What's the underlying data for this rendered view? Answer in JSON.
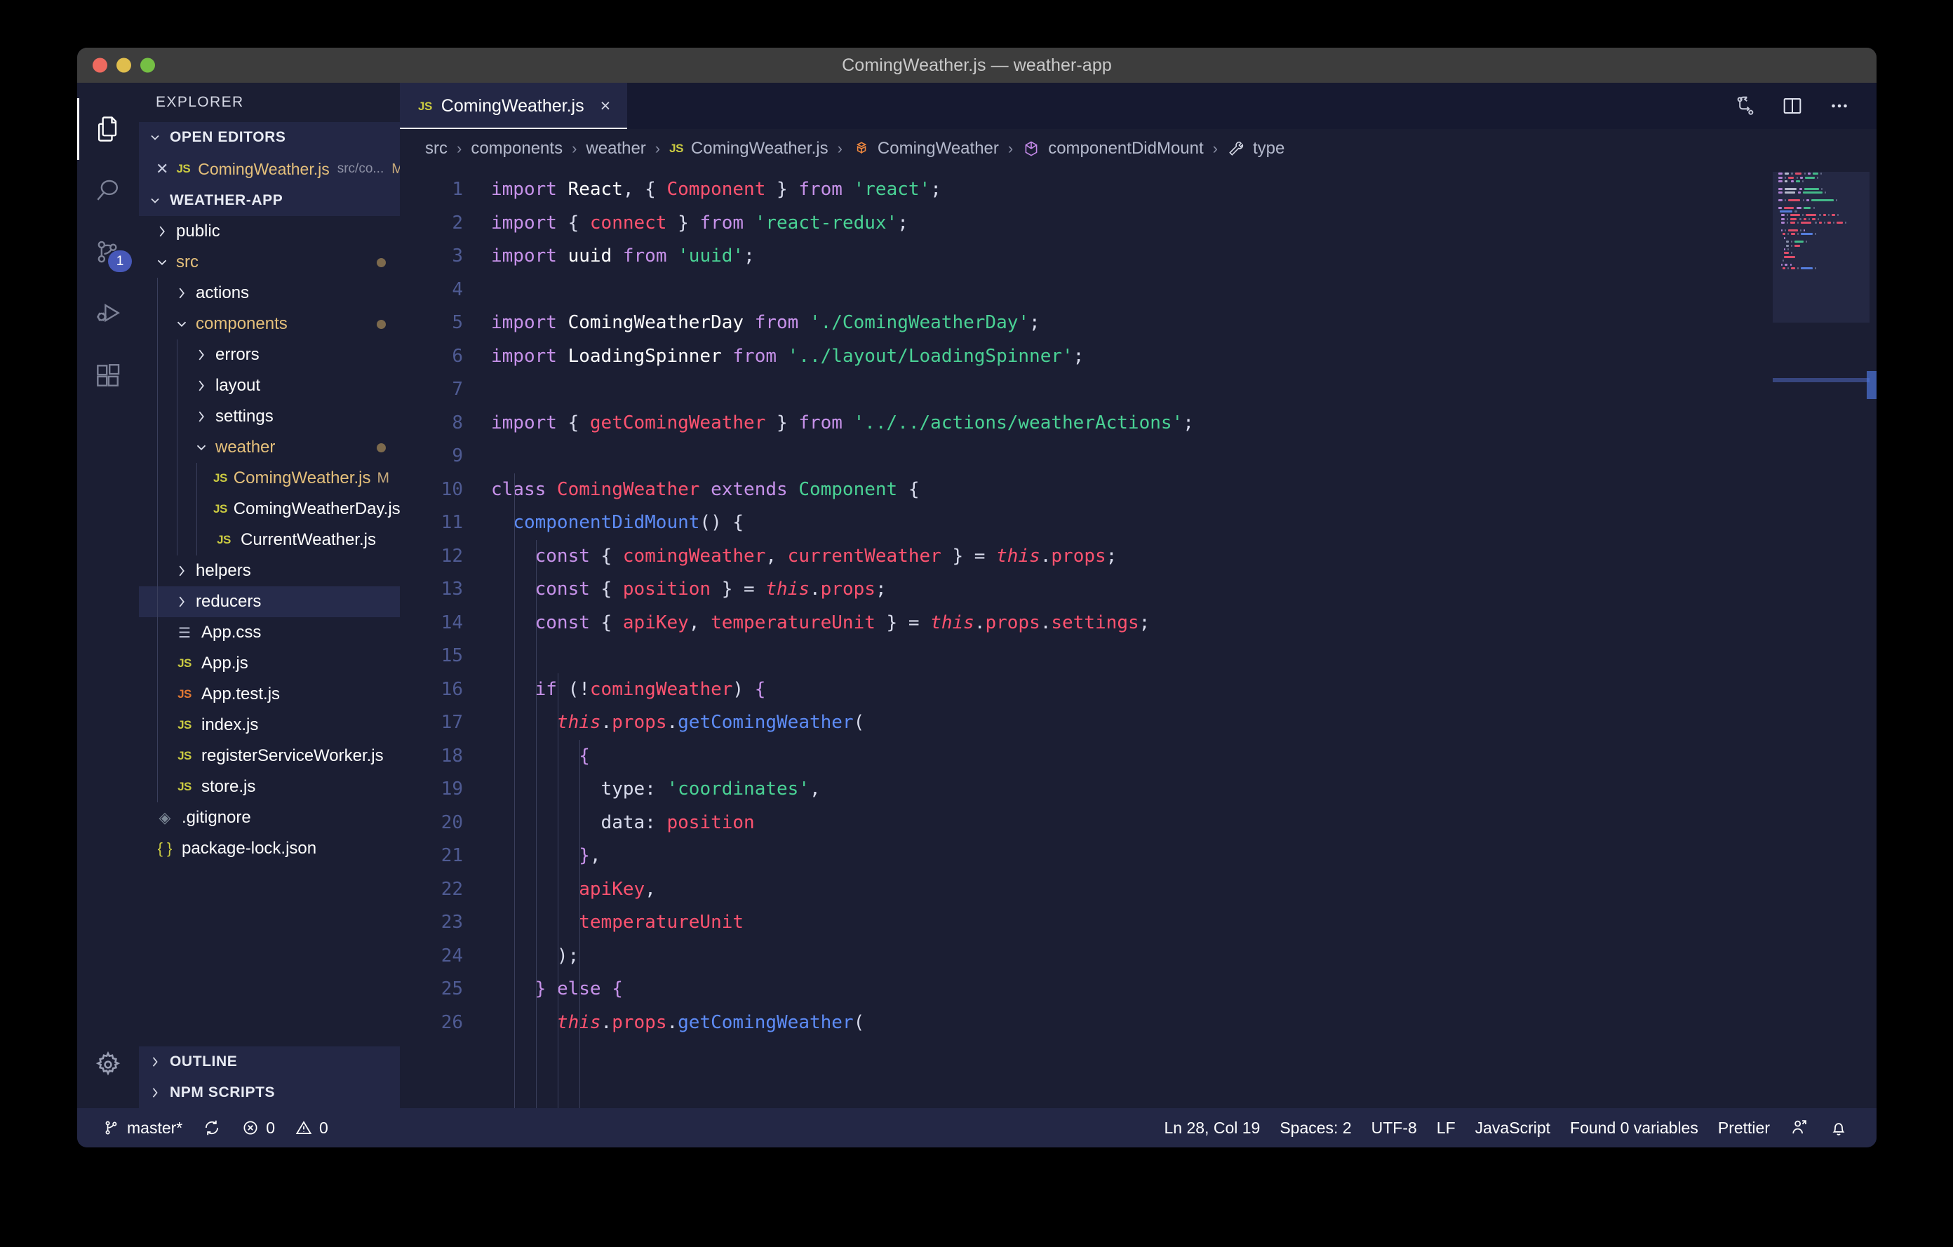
{
  "titlebar": {
    "title": "ComingWeather.js — weather-app"
  },
  "activitybar": {
    "items": [
      {
        "icon": "explorer-files-icon",
        "active": true
      },
      {
        "icon": "search-icon",
        "active": false
      },
      {
        "icon": "source-control-icon",
        "active": false,
        "badge": "1"
      },
      {
        "icon": "run-and-debug-icon",
        "active": false
      },
      {
        "icon": "extensions-icon",
        "active": false
      }
    ],
    "bottom": {
      "icon": "settings-gear-icon"
    }
  },
  "sidebar": {
    "title": "EXPLORER",
    "open_editors": {
      "header": "OPEN EDITORS",
      "items": [
        {
          "name": "ComingWeather.js",
          "path": "src/co...",
          "status": "M",
          "icon": "js-icon"
        }
      ]
    },
    "workspace": {
      "header": "WEATHER-APP",
      "tree": [
        {
          "label": "public",
          "type": "folder",
          "depth": 1,
          "expanded": false
        },
        {
          "label": "src",
          "type": "folder",
          "depth": 1,
          "expanded": true,
          "modified": true
        },
        {
          "label": "actions",
          "type": "folder",
          "depth": 2,
          "expanded": false
        },
        {
          "label": "components",
          "type": "folder",
          "depth": 2,
          "expanded": true,
          "modified": true
        },
        {
          "label": "errors",
          "type": "folder",
          "depth": 3,
          "expanded": false
        },
        {
          "label": "layout",
          "type": "folder",
          "depth": 3,
          "expanded": false
        },
        {
          "label": "settings",
          "type": "folder",
          "depth": 3,
          "expanded": false
        },
        {
          "label": "weather",
          "type": "folder",
          "depth": 3,
          "expanded": true,
          "modified": true
        },
        {
          "label": "ComingWeather.js",
          "type": "file",
          "depth": 4,
          "icon": "js-icon",
          "status": "M",
          "modified": true
        },
        {
          "label": "ComingWeatherDay.js",
          "type": "file",
          "depth": 4,
          "icon": "js-icon"
        },
        {
          "label": "CurrentWeather.js",
          "type": "file",
          "depth": 4,
          "icon": "js-icon"
        },
        {
          "label": "helpers",
          "type": "folder",
          "depth": 2,
          "expanded": false
        },
        {
          "label": "reducers",
          "type": "folder",
          "depth": 2,
          "expanded": false,
          "selected": true
        },
        {
          "label": "App.css",
          "type": "file",
          "depth": 2,
          "icon": "css-icon"
        },
        {
          "label": "App.js",
          "type": "file",
          "depth": 2,
          "icon": "js-icon"
        },
        {
          "label": "App.test.js",
          "type": "file",
          "depth": 2,
          "icon": "js-test-icon"
        },
        {
          "label": "index.js",
          "type": "file",
          "depth": 2,
          "icon": "js-icon"
        },
        {
          "label": "registerServiceWorker.js",
          "type": "file",
          "depth": 2,
          "icon": "js-icon"
        },
        {
          "label": "store.js",
          "type": "file",
          "depth": 2,
          "icon": "js-icon"
        },
        {
          "label": ".gitignore",
          "type": "file",
          "depth": 1,
          "icon": "git-icon"
        },
        {
          "label": "package-lock.json",
          "type": "file",
          "depth": 1,
          "icon": "json-icon"
        }
      ]
    },
    "outline_header": "OUTLINE",
    "npm_scripts_header": "NPM SCRIPTS"
  },
  "editor": {
    "tabs": [
      {
        "label": "ComingWeather.js",
        "icon": "js-icon",
        "close": "×",
        "active": true
      }
    ],
    "actions": [
      {
        "icon": "split-changes-icon"
      },
      {
        "icon": "split-editor-icon"
      },
      {
        "icon": "more-actions-icon"
      }
    ],
    "breadcrumb": [
      {
        "label": "src",
        "icon": null
      },
      {
        "label": "components",
        "icon": null
      },
      {
        "label": "weather",
        "icon": null
      },
      {
        "label": "ComingWeather.js",
        "icon": "js-icon"
      },
      {
        "label": "ComingWeather",
        "icon": "class-symbol-icon"
      },
      {
        "label": "componentDidMount",
        "icon": "method-symbol-icon"
      },
      {
        "label": "type",
        "icon": "property-symbol-icon"
      }
    ],
    "first_line": 1,
    "line_count": 26,
    "language": "JavaScript",
    "code_lines": [
      {
        "n": 1,
        "tokens": [
          {
            "t": "import ",
            "c": "kw"
          },
          {
            "t": "React",
            "c": "id"
          },
          {
            "t": ", { ",
            "c": "pl"
          },
          {
            "t": "Component",
            "c": "var"
          },
          {
            "t": " } ",
            "c": "pl"
          },
          {
            "t": "from ",
            "c": "kw"
          },
          {
            "t": "'react'",
            "c": "str"
          },
          {
            "t": ";",
            "c": "pl"
          }
        ]
      },
      {
        "n": 2,
        "tokens": [
          {
            "t": "import ",
            "c": "kw"
          },
          {
            "t": "{ ",
            "c": "pl"
          },
          {
            "t": "connect",
            "c": "var"
          },
          {
            "t": " } ",
            "c": "pl"
          },
          {
            "t": "from ",
            "c": "kw"
          },
          {
            "t": "'react-redux'",
            "c": "str"
          },
          {
            "t": ";",
            "c": "pl"
          }
        ]
      },
      {
        "n": 3,
        "tokens": [
          {
            "t": "import ",
            "c": "kw"
          },
          {
            "t": "uuid",
            "c": "id"
          },
          {
            "t": " ",
            "c": "pl"
          },
          {
            "t": "from ",
            "c": "kw"
          },
          {
            "t": "'uuid'",
            "c": "str"
          },
          {
            "t": ";",
            "c": "pl"
          }
        ]
      },
      {
        "n": 4,
        "tokens": []
      },
      {
        "n": 5,
        "tokens": [
          {
            "t": "import ",
            "c": "kw"
          },
          {
            "t": "ComingWeatherDay",
            "c": "id"
          },
          {
            "t": " ",
            "c": "pl"
          },
          {
            "t": "from ",
            "c": "kw"
          },
          {
            "t": "'./ComingWeatherDay'",
            "c": "str"
          },
          {
            "t": ";",
            "c": "pl"
          }
        ]
      },
      {
        "n": 6,
        "tokens": [
          {
            "t": "import ",
            "c": "kw"
          },
          {
            "t": "LoadingSpinner",
            "c": "id"
          },
          {
            "t": " ",
            "c": "pl"
          },
          {
            "t": "from ",
            "c": "kw"
          },
          {
            "t": "'../layout/LoadingSpinner'",
            "c": "str"
          },
          {
            "t": ";",
            "c": "pl"
          }
        ]
      },
      {
        "n": 7,
        "tokens": []
      },
      {
        "n": 8,
        "tokens": [
          {
            "t": "import ",
            "c": "kw"
          },
          {
            "t": "{ ",
            "c": "pl"
          },
          {
            "t": "getComingWeather",
            "c": "var"
          },
          {
            "t": " } ",
            "c": "pl"
          },
          {
            "t": "from ",
            "c": "kw"
          },
          {
            "t": "'../../actions/weatherActions'",
            "c": "str"
          },
          {
            "t": ";",
            "c": "pl"
          }
        ]
      },
      {
        "n": 9,
        "tokens": []
      },
      {
        "n": 10,
        "tokens": [
          {
            "t": "class ",
            "c": "kw"
          },
          {
            "t": "ComingWeather",
            "c": "var"
          },
          {
            "t": " extends ",
            "c": "kw"
          },
          {
            "t": "Component",
            "c": "cls"
          },
          {
            "t": " {",
            "c": "pl"
          }
        ]
      },
      {
        "n": 11,
        "tokens": [
          {
            "t": "  ",
            "c": "pl"
          },
          {
            "t": "componentDidMount",
            "c": "fn"
          },
          {
            "t": "() {",
            "c": "pl"
          }
        ]
      },
      {
        "n": 12,
        "tokens": [
          {
            "t": "    ",
            "c": "pl"
          },
          {
            "t": "const ",
            "c": "kw"
          },
          {
            "t": "{ ",
            "c": "pl"
          },
          {
            "t": "comingWeather",
            "c": "var"
          },
          {
            "t": ", ",
            "c": "pl"
          },
          {
            "t": "currentWeather",
            "c": "var"
          },
          {
            "t": " } = ",
            "c": "pl"
          },
          {
            "t": "this",
            "c": "var it"
          },
          {
            "t": ".",
            "c": "pl"
          },
          {
            "t": "props",
            "c": "var"
          },
          {
            "t": ";",
            "c": "pl"
          }
        ]
      },
      {
        "n": 13,
        "tokens": [
          {
            "t": "    ",
            "c": "pl"
          },
          {
            "t": "const ",
            "c": "kw"
          },
          {
            "t": "{ ",
            "c": "pl"
          },
          {
            "t": "position",
            "c": "var"
          },
          {
            "t": " } = ",
            "c": "pl"
          },
          {
            "t": "this",
            "c": "var it"
          },
          {
            "t": ".",
            "c": "pl"
          },
          {
            "t": "props",
            "c": "var"
          },
          {
            "t": ";",
            "c": "pl"
          }
        ]
      },
      {
        "n": 14,
        "tokens": [
          {
            "t": "    ",
            "c": "pl"
          },
          {
            "t": "const ",
            "c": "kw"
          },
          {
            "t": "{ ",
            "c": "pl"
          },
          {
            "t": "apiKey",
            "c": "var"
          },
          {
            "t": ", ",
            "c": "pl"
          },
          {
            "t": "temperatureUnit",
            "c": "var"
          },
          {
            "t": " } = ",
            "c": "pl"
          },
          {
            "t": "this",
            "c": "var it"
          },
          {
            "t": ".",
            "c": "pl"
          },
          {
            "t": "props",
            "c": "var"
          },
          {
            "t": ".",
            "c": "pl"
          },
          {
            "t": "settings",
            "c": "var"
          },
          {
            "t": ";",
            "c": "pl"
          }
        ]
      },
      {
        "n": 15,
        "tokens": []
      },
      {
        "n": 16,
        "tokens": [
          {
            "t": "    ",
            "c": "pl"
          },
          {
            "t": "if ",
            "c": "kw"
          },
          {
            "t": "(!",
            "c": "pl"
          },
          {
            "t": "comingWeather",
            "c": "var"
          },
          {
            "t": ") ",
            "c": "pl"
          },
          {
            "t": "{",
            "c": "kw"
          }
        ]
      },
      {
        "n": 17,
        "tokens": [
          {
            "t": "      ",
            "c": "pl"
          },
          {
            "t": "this",
            "c": "var it"
          },
          {
            "t": ".",
            "c": "pl"
          },
          {
            "t": "props",
            "c": "var"
          },
          {
            "t": ".",
            "c": "pl"
          },
          {
            "t": "getComingWeather",
            "c": "fn"
          },
          {
            "t": "(",
            "c": "pl"
          }
        ]
      },
      {
        "n": 18,
        "tokens": [
          {
            "t": "        ",
            "c": "pl"
          },
          {
            "t": "{",
            "c": "kw"
          }
        ]
      },
      {
        "n": 19,
        "tokens": [
          {
            "t": "          ",
            "c": "pl"
          },
          {
            "t": "type",
            "c": "prop"
          },
          {
            "t": ": ",
            "c": "pl"
          },
          {
            "t": "'coordinates'",
            "c": "str"
          },
          {
            "t": ",",
            "c": "pl"
          }
        ]
      },
      {
        "n": 20,
        "tokens": [
          {
            "t": "          ",
            "c": "pl"
          },
          {
            "t": "data",
            "c": "prop"
          },
          {
            "t": ": ",
            "c": "pl"
          },
          {
            "t": "position",
            "c": "var"
          }
        ]
      },
      {
        "n": 21,
        "tokens": [
          {
            "t": "        ",
            "c": "pl"
          },
          {
            "t": "}",
            "c": "kw"
          },
          {
            "t": ",",
            "c": "pl"
          }
        ]
      },
      {
        "n": 22,
        "tokens": [
          {
            "t": "        ",
            "c": "pl"
          },
          {
            "t": "apiKey",
            "c": "var"
          },
          {
            "t": ",",
            "c": "pl"
          }
        ]
      },
      {
        "n": 23,
        "tokens": [
          {
            "t": "        ",
            "c": "pl"
          },
          {
            "t": "temperatureUnit",
            "c": "var"
          }
        ]
      },
      {
        "n": 24,
        "tokens": [
          {
            "t": "      ",
            "c": "pl"
          },
          {
            "t": ");",
            "c": "pl"
          }
        ]
      },
      {
        "n": 25,
        "tokens": [
          {
            "t": "    ",
            "c": "pl"
          },
          {
            "t": "} ",
            "c": "kw"
          },
          {
            "t": "else",
            "c": "kw"
          },
          {
            "t": " ",
            "c": "pl"
          },
          {
            "t": "{",
            "c": "kw"
          }
        ]
      },
      {
        "n": 26,
        "tokens": [
          {
            "t": "      ",
            "c": "pl"
          },
          {
            "t": "this",
            "c": "var it"
          },
          {
            "t": ".",
            "c": "pl"
          },
          {
            "t": "props",
            "c": "var"
          },
          {
            "t": ".",
            "c": "pl"
          },
          {
            "t": "getComingWeather",
            "c": "fn"
          },
          {
            "t": "(",
            "c": "pl"
          }
        ]
      }
    ]
  },
  "statusbar": {
    "left": [
      {
        "name": "branch",
        "icon": "source-control-branch-icon",
        "label": "master*"
      },
      {
        "name": "sync",
        "icon": "sync-icon",
        "label": ""
      },
      {
        "name": "errors",
        "icon": "error-icon",
        "label": "0"
      },
      {
        "name": "warnings",
        "icon": "warning-icon",
        "label": "0"
      }
    ],
    "right": [
      {
        "name": "cursor-position",
        "label": "Ln 28, Col 19"
      },
      {
        "name": "indentation",
        "label": "Spaces: 2"
      },
      {
        "name": "encoding",
        "label": "UTF-8"
      },
      {
        "name": "eol",
        "label": "LF"
      },
      {
        "name": "language-mode",
        "label": "JavaScript"
      },
      {
        "name": "found-variables",
        "label": "Found 0 variables"
      },
      {
        "name": "formatter",
        "label": "Prettier"
      },
      {
        "name": "live-share",
        "icon": "live-share-icon",
        "label": ""
      },
      {
        "name": "notifications",
        "icon": "bell-icon",
        "label": ""
      }
    ]
  },
  "colors": {
    "editor_bg": "#1b1e33",
    "sidebar_bg": "#1b1e33",
    "section_bg": "#232745",
    "accent": "#4758b8",
    "keyword": "#c792ea",
    "variable": "#ff5370",
    "string": "#4ad295",
    "function": "#5e8cf7",
    "line_number": "#4f5b93"
  }
}
